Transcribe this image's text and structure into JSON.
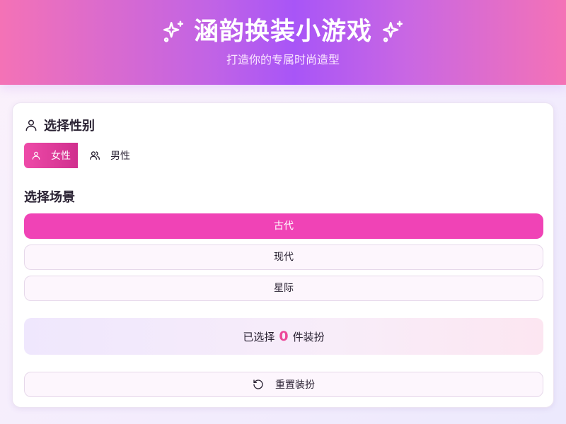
{
  "header": {
    "title": "涵韵换装小游戏",
    "subtitle": "打造你的专属时尚造型",
    "left_icon": "sparkles-icon",
    "right_icon": "sparkles-icon"
  },
  "gender": {
    "title": "选择性别",
    "title_icon": "user-icon",
    "options": [
      {
        "label": "女性",
        "icon": "user-icon",
        "selected": true
      },
      {
        "label": "男性",
        "icon": "users-icon",
        "selected": false
      }
    ]
  },
  "scene": {
    "title": "选择场景",
    "options": [
      {
        "label": "古代",
        "selected": true
      },
      {
        "label": "现代",
        "selected": false
      },
      {
        "label": "星际",
        "selected": false
      }
    ]
  },
  "selection": {
    "prefix": "已选择",
    "count": "0",
    "suffix": "件装扮"
  },
  "reset": {
    "label": "重置装扮",
    "icon": "rotate-ccw-icon"
  },
  "colors": {
    "accent_pink": "#f043b6",
    "accent_purple": "#a855f7",
    "count_color": "#ec4899"
  }
}
